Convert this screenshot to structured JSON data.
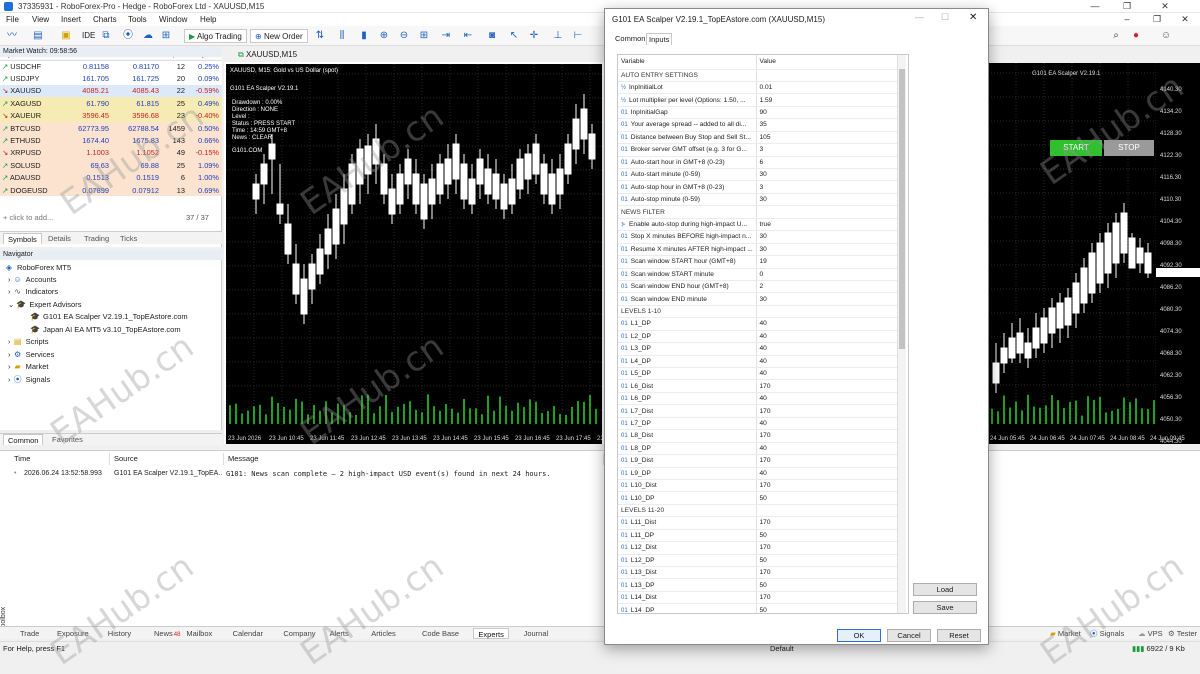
{
  "window": {
    "title": "37335931 - RoboForex-Pro - Hedge - RoboForex Ltd - XAUUSD,M15"
  },
  "menu": [
    "File",
    "View",
    "Insert",
    "Charts",
    "Tools",
    "Window",
    "Help"
  ],
  "toolbar": {
    "ide": "IDE",
    "algo_trading": "Algo Trading",
    "new_order": "New Order"
  },
  "market_watch": {
    "title": "Market Watch: 09:58:56",
    "columns": [
      "Symbol",
      "Bid",
      "Ask",
      "Spr...",
      "Daily C..."
    ],
    "rows": [
      {
        "dir": "up",
        "symbol": "USDCHF",
        "bid": "0.81158",
        "ask": "0.81170",
        "spread": "12",
        "change": "0.25%"
      },
      {
        "dir": "up",
        "symbol": "USDJPY",
        "bid": "161.705",
        "ask": "161.725",
        "spread": "20",
        "change": "0.09%"
      },
      {
        "dir": "dn",
        "symbol": "XAUUSD",
        "bid": "4085.21",
        "ask": "4085.43",
        "spread": "22",
        "change": "-0.59%"
      },
      {
        "dir": "up",
        "symbol": "XAGUSD",
        "bid": "61.790",
        "ask": "61.815",
        "spread": "25",
        "change": "0.49%"
      },
      {
        "dir": "dn",
        "symbol": "XAUEUR",
        "bid": "3596.45",
        "ask": "3596.68",
        "spread": "23",
        "change": "-0.40%"
      },
      {
        "dir": "up",
        "symbol": "BTCUSD",
        "bid": "62773.95",
        "ask": "62788.54",
        "spread": "1459",
        "change": "0.50%"
      },
      {
        "dir": "up",
        "symbol": "ETHUSD",
        "bid": "1674.40",
        "ask": "1675.83",
        "spread": "143",
        "change": "0.66%"
      },
      {
        "dir": "dn",
        "symbol": "XRPUSD",
        "bid": "1.1003",
        "ask": "1.1052",
        "spread": "49",
        "change": "-0.15%"
      },
      {
        "dir": "up",
        "symbol": "SOLUSD",
        "bid": "69.63",
        "ask": "69.88",
        "spread": "25",
        "change": "1.09%"
      },
      {
        "dir": "up",
        "symbol": "ADAUSD",
        "bid": "0.1513",
        "ask": "0.1519",
        "spread": "6",
        "change": "1.00%"
      },
      {
        "dir": "up",
        "symbol": "DOGEUSD",
        "bid": "0.07899",
        "ask": "0.07912",
        "spread": "13",
        "change": "0.69%"
      }
    ],
    "add_label": "click to add...",
    "count": "37 / 37",
    "tabs": [
      "Symbols",
      "Details",
      "Trading",
      "Ticks"
    ]
  },
  "navigator": {
    "title": "Navigator",
    "root": "RoboForex MT5",
    "items": [
      "Accounts",
      "Indicators",
      "Expert Advisors",
      "G101 EA Scalper V2.19.1_TopEAstore.com",
      "Japan AI EA MT5 v3.10_TopEAstore.com",
      "Scripts",
      "Services",
      "Market",
      "Signals"
    ],
    "tabs": [
      "Common",
      "Favorites"
    ]
  },
  "chart": {
    "tab": "XAUUSD,M15",
    "symbol_line": "XAUUSD, M15:  Gold vs US Dollar (spot)",
    "ea_name": "G101 EA Scalper V2.19.1",
    "drawdown": "Drawdown :  0.00%",
    "direction": "Direction : NONE",
    "level": "Level :",
    "status": "Status :   PRESS START",
    "time": "Time :     14:59 GMT+8",
    "news": "News :     CLEAR",
    "site": "G101.COM",
    "start": "START",
    "stop": "STOP",
    "time_labels": [
      "23 Jun 2026",
      "23 Jun 10:45",
      "23 Jun 11:45",
      "23 Jun 12:45",
      "23 Jun 13:45",
      "23 Jun 14:45",
      "23 Jun 15:45",
      "23 Jun 16:45",
      "23 Jun 17:45",
      "23 Jun"
    ],
    "right_time_labels": [
      "24 Jun 05:45",
      "24 Jun 06:45",
      "24 Jun 07:45",
      "24 Jun 08:45",
      "24 Jun 09:45"
    ],
    "price_labels": [
      "4140.30",
      "4134.20",
      "4128.30",
      "4122.30",
      "4116.30",
      "4110.30",
      "4104.30",
      "4098.30",
      "4092.30",
      "4086.20",
      "4080.30",
      "4074.30",
      "4068.30",
      "4062.30",
      "4056.30",
      "4050.30",
      "4044.30"
    ]
  },
  "journal": {
    "columns": [
      "Time",
      "Source",
      "Message"
    ],
    "time": "2026.06.24 13:52:58.993",
    "source": "G101 EA Scalper V2.19.1_TopEA...",
    "message": "G101: News scan complete — 2 high-impact USD event(s) found in next 24 hours."
  },
  "bottom_tabs": [
    "Trade",
    "Exposure",
    "History",
    "News",
    "Mailbox",
    "Calendar",
    "Company",
    "Alerts",
    "Articles",
    "Code Base",
    "Experts",
    "Journal"
  ],
  "news_badge": "48",
  "bottom_right": [
    "Market",
    "Signals",
    "VPS",
    "Tester"
  ],
  "status": {
    "left": "For Help, press F1",
    "middle": "Default",
    "right": "6922 / 9 Kb"
  },
  "toolbox": "Toolbox",
  "dialog": {
    "title": "G101 EA Scalper V2.19.1_TopEAstore.com (XAUUSD,M15)",
    "tabs": [
      "Common",
      "Inputs"
    ],
    "columns": [
      "Variable",
      "Value"
    ],
    "rows": [
      {
        "type": "section",
        "name": "AUTO ENTRY SETTINGS",
        "value": ""
      },
      {
        "type": "frac",
        "name": "InpInitialLot",
        "value": "0.01"
      },
      {
        "type": "frac",
        "name": "Lot multiplier per level (Options: 1.50, ...",
        "value": "1.59"
      },
      {
        "type": "int",
        "name": "InpInitialGap",
        "value": "90"
      },
      {
        "type": "int",
        "name": "Your average spread -- added to all di...",
        "value": "35"
      },
      {
        "type": "int",
        "name": "Distance between Buy Stop and Sell St...",
        "value": "105"
      },
      {
        "type": "int",
        "name": "Broker server GMT offset (e.g. 3 for G...",
        "value": "3"
      },
      {
        "type": "int",
        "name": "Auto-start hour in GMT+8 (0-23)",
        "value": "6"
      },
      {
        "type": "int",
        "name": "Auto-start minute (0-59)",
        "value": "30"
      },
      {
        "type": "int",
        "name": "Auto-stop hour in GMT+8 (0-23)",
        "value": "3"
      },
      {
        "type": "int",
        "name": "Auto-stop minute (0-59)",
        "value": "30"
      },
      {
        "type": "section",
        "name": "NEWS FILTER",
        "value": ""
      },
      {
        "type": "bool",
        "name": "Enable auto-stop during high-impact U...",
        "value": "true"
      },
      {
        "type": "int",
        "name": "Stop X minutes BEFORE high-impact n...",
        "value": "30"
      },
      {
        "type": "int",
        "name": "Resume X minutes AFTER high-impact ...",
        "value": "30"
      },
      {
        "type": "int",
        "name": "Scan window START hour (GMT+8)",
        "value": "19"
      },
      {
        "type": "int",
        "name": "Scan window START minute",
        "value": "0"
      },
      {
        "type": "int",
        "name": "Scan window END hour (GMT+8)",
        "value": "2"
      },
      {
        "type": "int",
        "name": "Scan window END minute",
        "value": "30"
      },
      {
        "type": "section",
        "name": "LEVELS 1-10",
        "value": ""
      },
      {
        "type": "int",
        "name": "L1_DP",
        "value": "40"
      },
      {
        "type": "int",
        "name": "L2_DP",
        "value": "40"
      },
      {
        "type": "int",
        "name": "L3_DP",
        "value": "40"
      },
      {
        "type": "int",
        "name": "L4_DP",
        "value": "40"
      },
      {
        "type": "int",
        "name": "L5_DP",
        "value": "40"
      },
      {
        "type": "int",
        "name": "L6_Dist",
        "value": "170"
      },
      {
        "type": "int",
        "name": "L6_DP",
        "value": "40"
      },
      {
        "type": "int",
        "name": "L7_Dist",
        "value": "170"
      },
      {
        "type": "int",
        "name": "L7_DP",
        "value": "40"
      },
      {
        "type": "int",
        "name": "L8_Dist",
        "value": "170"
      },
      {
        "type": "int",
        "name": "L8_DP",
        "value": "40"
      },
      {
        "type": "int",
        "name": "L9_Dist",
        "value": "170"
      },
      {
        "type": "int",
        "name": "L9_DP",
        "value": "40"
      },
      {
        "type": "int",
        "name": "L10_Dist",
        "value": "170"
      },
      {
        "type": "int",
        "name": "L10_DP",
        "value": "50"
      },
      {
        "type": "section",
        "name": "LEVELS 11-20",
        "value": ""
      },
      {
        "type": "int",
        "name": "L11_Dist",
        "value": "170"
      },
      {
        "type": "int",
        "name": "L11_DP",
        "value": "50"
      },
      {
        "type": "int",
        "name": "L12_Dist",
        "value": "170"
      },
      {
        "type": "int",
        "name": "L12_DP",
        "value": "50"
      },
      {
        "type": "int",
        "name": "L13_Dist",
        "value": "170"
      },
      {
        "type": "int",
        "name": "L13_DP",
        "value": "50"
      },
      {
        "type": "int",
        "name": "L14_Dist",
        "value": "170"
      },
      {
        "type": "int",
        "name": "L14_DP",
        "value": "50"
      }
    ],
    "load": "Load",
    "save": "Save",
    "ok": "OK",
    "cancel": "Cancel",
    "reset": "Reset"
  },
  "watermark": "EAHub.cn"
}
